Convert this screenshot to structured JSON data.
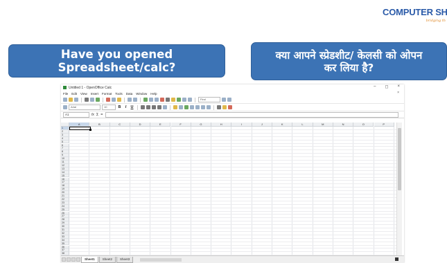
{
  "brand": {
    "name": "COMPUTER SHI",
    "tagline": "bridging th"
  },
  "banners": {
    "english": "Have you opened Spreadsheet/calc?",
    "hindi_line1": "क्या आपने स्प्रेडशीट/ केलसी को ओपन",
    "hindi_line2": "कर लिया है?"
  },
  "window": {
    "title": "Untitled 1 - OpenOffice Calc",
    "controls": {
      "minimize": "–",
      "maximize": "◻",
      "close": "×"
    },
    "menu_close": "×",
    "menu": [
      "File",
      "Edit",
      "View",
      "Insert",
      "Format",
      "Tools",
      "Data",
      "Window",
      "Help"
    ],
    "toolbar": {
      "find_field": "Find"
    },
    "format": {
      "font_name": "Arial",
      "font_size": "10",
      "bold": "B",
      "italic": "I",
      "underline": "U"
    },
    "formula_bar": {
      "name_box": "A1",
      "fx": "fx",
      "sum": "Σ",
      "equals": "="
    }
  },
  "grid": {
    "columns": [
      "A",
      "B",
      "C",
      "D",
      "E",
      "F",
      "G",
      "H",
      "I",
      "J",
      "K",
      "L",
      "M",
      "N",
      "O",
      "P"
    ],
    "rows": [
      "1",
      "2",
      "3",
      "4",
      "5",
      "6",
      "7",
      "8",
      "9",
      "10",
      "11",
      "12",
      "13",
      "14",
      "15",
      "16",
      "17",
      "18",
      "19",
      "20",
      "21",
      "22",
      "23",
      "24",
      "25",
      "26",
      "27",
      "28",
      "29",
      "30",
      "31",
      "32",
      "33",
      "34",
      "35",
      "36",
      "37",
      "38"
    ],
    "active_cell": "A1"
  },
  "sheet_tabs": [
    "Sheet1",
    "Sheet2",
    "Sheet3"
  ],
  "icons": [
    "app-icon",
    "new-icon",
    "open-icon",
    "save-icon",
    "print-icon",
    "cut-icon",
    "copy-icon",
    "paste-icon",
    "undo-icon",
    "redo-icon",
    "sort-icon",
    "chart-icon",
    "help-icon"
  ]
}
